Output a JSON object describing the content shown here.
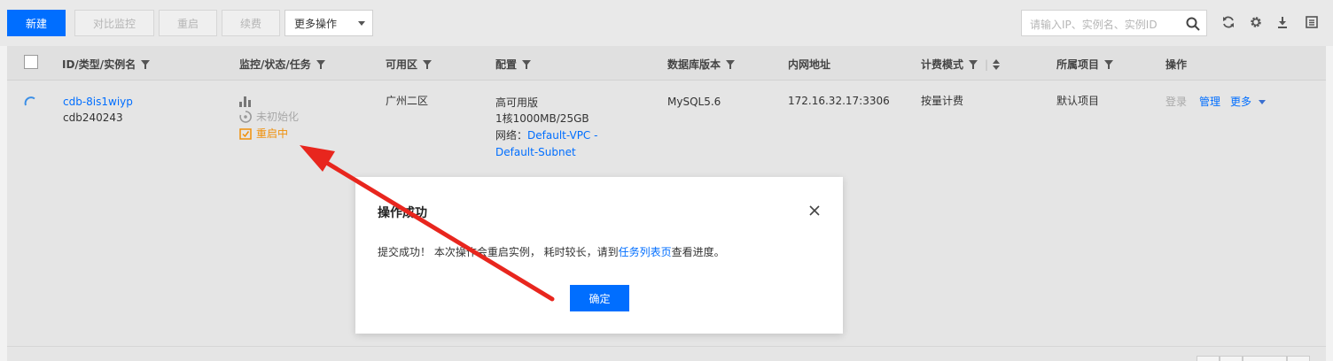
{
  "toolbar": {
    "new_label": "新建",
    "compare_label": "对比监控",
    "restart_label": "重启",
    "renew_label": "续费",
    "more_ops_label": "更多操作",
    "search_placeholder": "请输入IP、实例名、实例ID",
    "icons": [
      "search-icon",
      "refresh-icon",
      "settings-icon",
      "download-icon",
      "list-icon"
    ]
  },
  "table": {
    "headers": {
      "id": "ID/类型/实例名",
      "monitor": "监控/状态/任务",
      "zone": "可用区",
      "config": "配置",
      "db_version": "数据库版本",
      "address": "内网地址",
      "billing": "计费模式",
      "project": "所属项目",
      "ops": "操作"
    },
    "row": {
      "id": "cdb-8is1wiyp",
      "name": "cdb240243",
      "status": "未初始化",
      "task": "重启中",
      "zone": "广州二区",
      "config_type": "高可用版",
      "config_spec": "1核1000MB/25GB",
      "network_label": "网络：",
      "network_vpc": "Default-VPC -",
      "network_subnet": "Default-Subnet",
      "db_version": "MySQL5.6",
      "address": "172.16.32.17:3306",
      "billing": "按量计费",
      "project": "默认项目",
      "op_login": "登录",
      "op_manage": "管理",
      "op_more": "更多"
    }
  },
  "modal": {
    "title": "操作成功",
    "body_prefix": "提交成功！ 本次操作会重启实例， 耗时较长，请到",
    "body_link": "任务列表页",
    "body_suffix": "查看进度。",
    "ok_label": "确定"
  },
  "colors": {
    "primary": "#006eff",
    "task_orange": "#f0900a",
    "arrow_red": "#e8261e"
  }
}
